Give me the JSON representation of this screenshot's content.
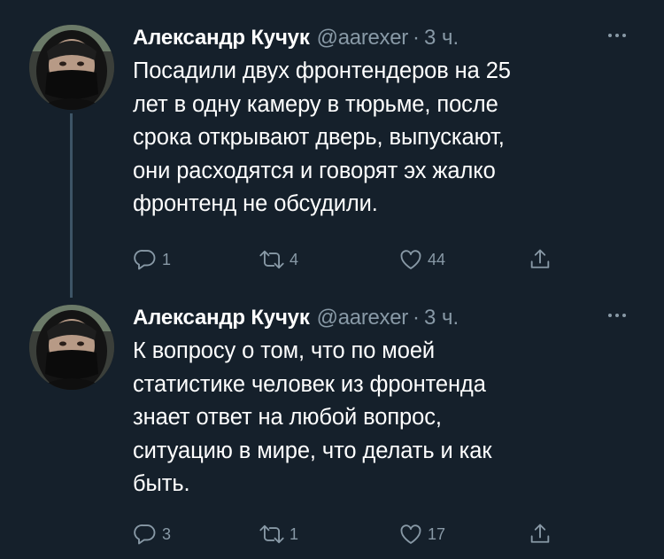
{
  "tweets": [
    {
      "author_name": "Александр Кучук",
      "handle": "@aarexer",
      "separator": "·",
      "time": "3 ч.",
      "text": "Посадили двух фронтендеров на 25\nлет в одну камеру в тюрьме, после\nсрока открывают дверь, выпускают,\nони расходятся и говорят эх жалко\nфронтенд не обсудили.",
      "replies": "1",
      "retweets": "4",
      "likes": "44"
    },
    {
      "author_name": "Александр Кучук",
      "handle": "@aarexer",
      "separator": "·",
      "time": "3 ч.",
      "text": "К вопросу о том, что по моей\nстатистике человек из фронтенда\nзнает ответ на любой вопрос,\nситуацию в мире, что делать и как\nбыть.",
      "replies": "3",
      "retweets": "1",
      "likes": "17"
    }
  ],
  "colors": {
    "background": "#15202b",
    "text": "#ffffff",
    "secondary": "#8899a6",
    "thread_line": "#3d5466"
  },
  "icons": {
    "more": "more-icon",
    "reply": "reply-icon",
    "retweet": "retweet-icon",
    "like": "heart-icon",
    "share": "share-icon"
  }
}
